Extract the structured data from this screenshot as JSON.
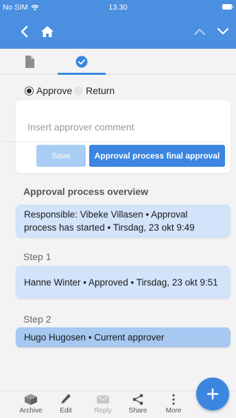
{
  "status_bar": {
    "carrier": "No SIM",
    "time": "13.30"
  },
  "tabs": [
    {
      "name": "documents",
      "icon": "document-icon"
    },
    {
      "name": "approval",
      "icon": "check-circle-icon",
      "active": true
    }
  ],
  "decision": {
    "options": [
      {
        "label": "Approve",
        "selected": true
      },
      {
        "label": "Return",
        "selected": false
      }
    ]
  },
  "comment": {
    "placeholder": "Insert approver comment",
    "value": ""
  },
  "actions": {
    "save_label": "Save",
    "final_label": "Approval process final approval"
  },
  "overview": {
    "title": "Approval process overview",
    "summary": "Responsible: Vibeke Villasen • Approval process has started • Tirsdag, 23 okt 9:49",
    "steps": [
      {
        "label": "Step 1",
        "text": "Hanne Winter • Approved • Tirsdag, 23 okt 9:51"
      },
      {
        "label": "Step 2",
        "text": "Hugo Hugosen • Current approver"
      }
    ]
  },
  "toolbar": {
    "items": [
      {
        "label": "Archive",
        "icon": "archive-icon"
      },
      {
        "label": "Edit",
        "icon": "pencil-icon"
      },
      {
        "label": "Reply",
        "icon": "mail-icon",
        "disabled": true
      },
      {
        "label": "Share",
        "icon": "share-icon"
      },
      {
        "label": "More",
        "icon": "more-vertical-icon"
      }
    ]
  },
  "fab": {
    "icon": "plus-icon"
  },
  "colors": {
    "primary": "#3b86e0",
    "header": "#4a8fe0",
    "card_light": "#d2e3fa",
    "card_current": "#a6c8f1",
    "save_disabled": "#a9cdf5"
  }
}
